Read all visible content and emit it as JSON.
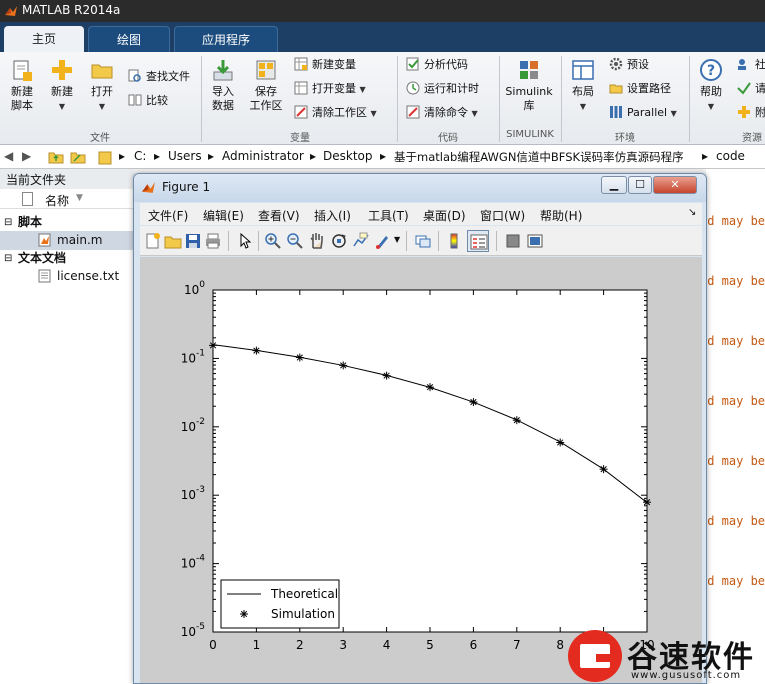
{
  "app": {
    "title": "MATLAB R2014a"
  },
  "tabs": [
    {
      "label": "主页",
      "active": true
    },
    {
      "label": "绘图",
      "active": false
    },
    {
      "label": "应用程序",
      "active": false
    }
  ],
  "ribbon": {
    "file": {
      "new_script": "新建\n脚本",
      "new": "新建",
      "open": "打开",
      "find_files": "查找文件",
      "compare": "比较",
      "group": "文件"
    },
    "variable": {
      "import": "导入\n数据",
      "save_ws": "保存\n工作区",
      "new_var": "新建变量",
      "open_var": "打开变量",
      "clear_ws": "清除工作区",
      "group": "变量"
    },
    "code": {
      "analyze": "分析代码",
      "run_time": "运行和计时",
      "clear_cmd": "清除命令",
      "group": "代码"
    },
    "simulink": {
      "lib": "Simulink\n库",
      "group": "SIMULINK"
    },
    "env": {
      "layout": "布局",
      "prefs": "预设",
      "set_path": "设置路径",
      "parallel": "Parallel",
      "group": "环境"
    },
    "resources": {
      "help": "帮助",
      "community": "社",
      "request": "请",
      "addons": "附",
      "group": "资源"
    }
  },
  "address": [
    "C:",
    "Users",
    "Administrator",
    "Desktop",
    "基于matlab编程AWGN信道中BFSK误码率仿真源码程序",
    "code"
  ],
  "left_panel": {
    "title": "当前文件夹",
    "col_name": "名称",
    "groups": [
      {
        "label": "脚本",
        "files": [
          "main.m"
        ]
      },
      {
        "label": "文本文档",
        "files": [
          "license.txt"
        ]
      }
    ]
  },
  "editor_fragment": "nd may be",
  "figure": {
    "title": "Figure 1",
    "menus": [
      "文件(F)",
      "编辑(E)",
      "查看(V)",
      "插入(I)",
      "工具(T)",
      "桌面(D)",
      "窗口(W)",
      "帮助(H)"
    ]
  },
  "chart_data": {
    "type": "line",
    "title": "",
    "xlabel": "",
    "ylabel": "",
    "x": [
      0,
      1,
      2,
      3,
      4,
      5,
      6,
      7,
      8,
      9,
      10
    ],
    "xlim": [
      0,
      10
    ],
    "ylim": [
      1e-05,
      1
    ],
    "yscale": "log",
    "x_ticks": [
      "0",
      "1",
      "2",
      "3",
      "4",
      "5",
      "6",
      "7",
      "8",
      "9",
      "10"
    ],
    "y_ticks": [
      {
        "base": "10",
        "exp": "0",
        "value": 1
      },
      {
        "base": "10",
        "exp": "-1",
        "value": 0.1
      },
      {
        "base": "10",
        "exp": "-2",
        "value": 0.01
      },
      {
        "base": "10",
        "exp": "-3",
        "value": 0.001
      },
      {
        "base": "10",
        "exp": "-4",
        "value": 0.0001
      },
      {
        "base": "10",
        "exp": "-5",
        "value": 1e-05
      }
    ],
    "grid": false,
    "legend": "bottom-left",
    "series": [
      {
        "name": "Theoretical",
        "style": "line",
        "color": "#000000",
        "values": [
          0.1587,
          0.1309,
          0.104,
          0.0789,
          0.0565,
          0.0377,
          0.023,
          0.0126,
          0.006,
          0.0024,
          0.00078
        ]
      },
      {
        "name": "Simulation",
        "style": "marker",
        "marker": "*",
        "color": "#000000",
        "values": [
          0.155,
          0.13,
          0.103,
          0.079,
          0.056,
          0.038,
          0.023,
          0.0125,
          0.0059,
          0.0024,
          0.00079
        ]
      }
    ]
  },
  "watermark": {
    "text": "谷速软件",
    "url": "www.gususoft.com"
  }
}
